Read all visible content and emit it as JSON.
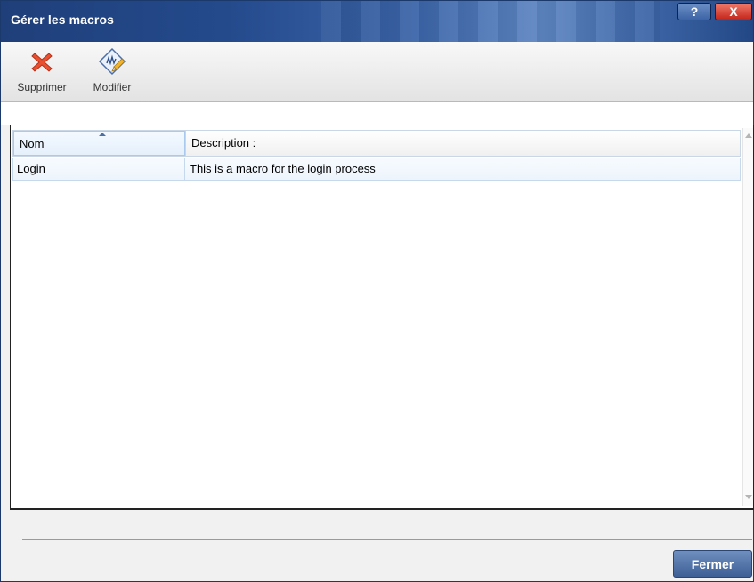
{
  "window": {
    "title": "Gérer les macros",
    "help_label": "?",
    "close_label": "X"
  },
  "toolbar": {
    "delete_label": "Supprimer",
    "edit_label": "Modifier"
  },
  "grid": {
    "columns": [
      "Nom",
      "Description :"
    ],
    "rows": [
      {
        "name": "Login",
        "description": "This is a macro for the login process"
      }
    ]
  },
  "footer": {
    "close_button_label": "Fermer"
  },
  "colors": {
    "title_bar": "#244a8c",
    "close_button": "#c3261a",
    "primary_button": "#3d5f95"
  }
}
